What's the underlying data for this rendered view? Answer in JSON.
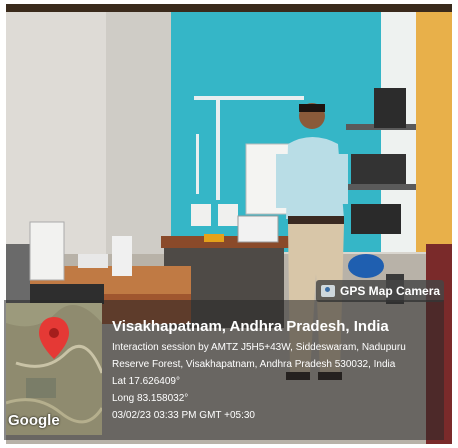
{
  "badge": {
    "label": "GPS Map Camera",
    "icon": "camera-map-icon"
  },
  "location": {
    "title": "Visakhapatnam, Andhra Pradesh, India",
    "line1": "Interaction session by AMTZ J5H5+43W, Siddeswaram, Nadupuru",
    "line2": "Reserve Forest, Visakhapatnam, Andhra Pradesh 530032, India",
    "lat": "Lat 17.626409°",
    "long": "Long 83.158032°",
    "datetime": "03/02/23 03:33 PM GMT +05:30"
  },
  "map": {
    "provider": "Google",
    "pin_color": "#e53935"
  }
}
